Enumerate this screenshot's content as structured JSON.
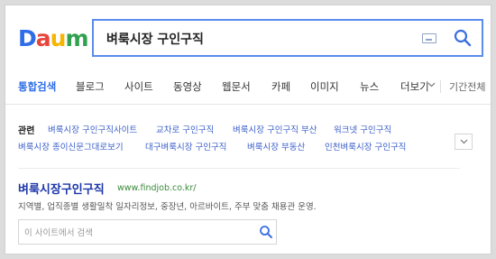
{
  "logo": {
    "letters": [
      "D",
      "a",
      "u",
      "m"
    ],
    "colors": [
      "#2f6ee8",
      "#e8453c",
      "#f7b400",
      "#30a14e"
    ]
  },
  "search": {
    "query": "벼룩시장 구인구직"
  },
  "tabs": [
    {
      "label": "통합검색",
      "active": true
    },
    {
      "label": "블로그"
    },
    {
      "label": "사이트"
    },
    {
      "label": "동영상"
    },
    {
      "label": "웹문서"
    },
    {
      "label": "카페"
    },
    {
      "label": "이미지"
    },
    {
      "label": "뉴스"
    },
    {
      "label": "더보기"
    }
  ],
  "period_label": "기간전체",
  "related": {
    "title": "관련",
    "row1": [
      "벼룩시장 구인구직사이트",
      "교차로 구인구직",
      "벼룩시장 구인구직 부산",
      "워크넷 구인구직"
    ],
    "row2": [
      "벼룩시장 종이신문그대로보기",
      "대구벼룩시장 구인구직",
      "벼룩시장 부동산",
      "인천벼룩시장 구인구직"
    ]
  },
  "result": {
    "title": "벼룩시장구인구직",
    "url": "www.findjob.co.kr/",
    "description": "지역별, 업직종별 생활밀착 일자리정보, 중장년, 아르바이트, 주부 맞춤 채용관 운영.",
    "site_search_placeholder": "이 사이트에서 검색"
  }
}
